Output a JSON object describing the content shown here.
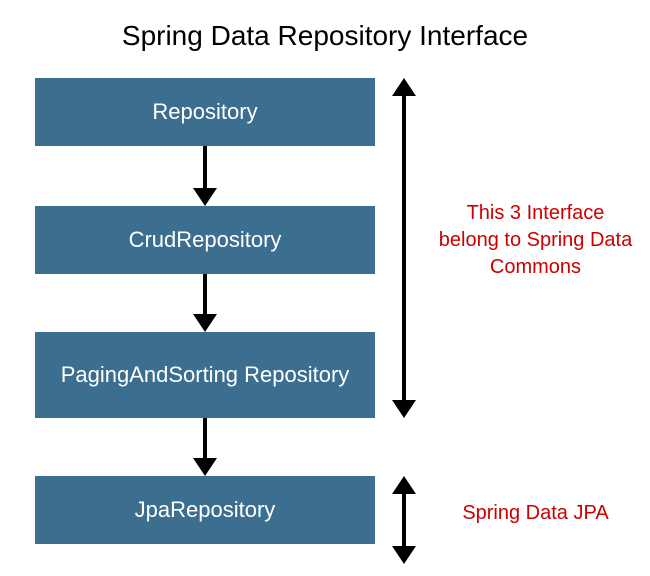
{
  "title": "Spring Data Repository Interface",
  "boxes": {
    "repository": "Repository",
    "crud": "CrudRepository",
    "paging": "PagingAndSorting Repository",
    "jpa": "JpaRepository"
  },
  "annotations": {
    "commons": "This 3 Interface belong to Spring Data Commons",
    "jpa": "Spring Data JPA"
  },
  "colors": {
    "boxBg": "#3b6e8f",
    "boxText": "#ffffff",
    "annotation": "#cc0000",
    "arrow": "#000000"
  }
}
